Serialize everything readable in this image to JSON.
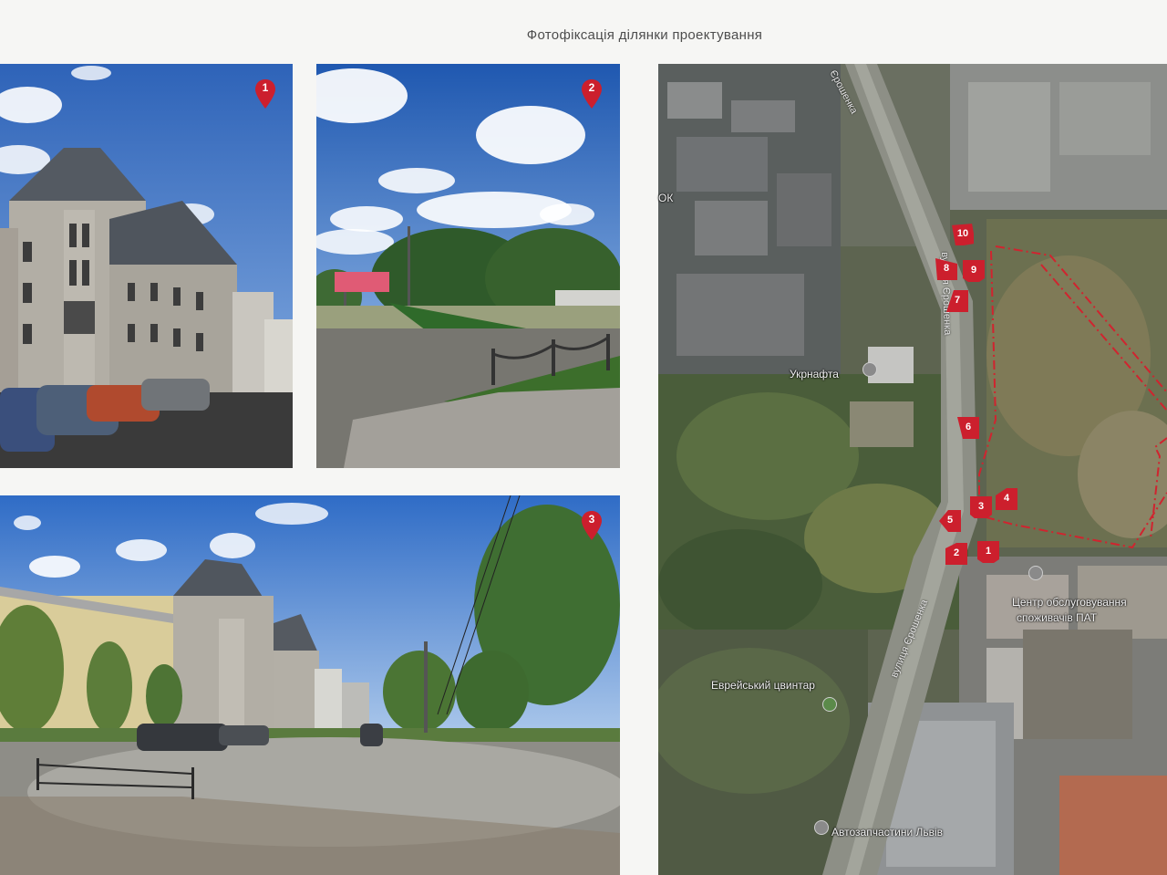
{
  "header": {
    "title": "Фотофіксація ділянки проектування"
  },
  "photos": [
    {
      "marker": "1"
    },
    {
      "marker": "2"
    },
    {
      "marker": "3"
    }
  ],
  "map": {
    "labels": {
      "ukrnafta": "Укрнафта",
      "service_center": "Центр обслуговування",
      "service_center_2": "споживачів ПАТ",
      "jewish_cemetery": "Еврейський цвинтар",
      "auto_parts": "Автозапчастини Львів",
      "ok": "ОК"
    },
    "streets": {
      "street_1": "вулиця Єрошенка",
      "street_2": "вулиця Єрошенка",
      "street_3": "Єрошенка"
    },
    "markers": [
      "1",
      "2",
      "3",
      "4",
      "5",
      "6",
      "7",
      "8",
      "9",
      "10"
    ],
    "accent_color": "#cc1f2d"
  }
}
